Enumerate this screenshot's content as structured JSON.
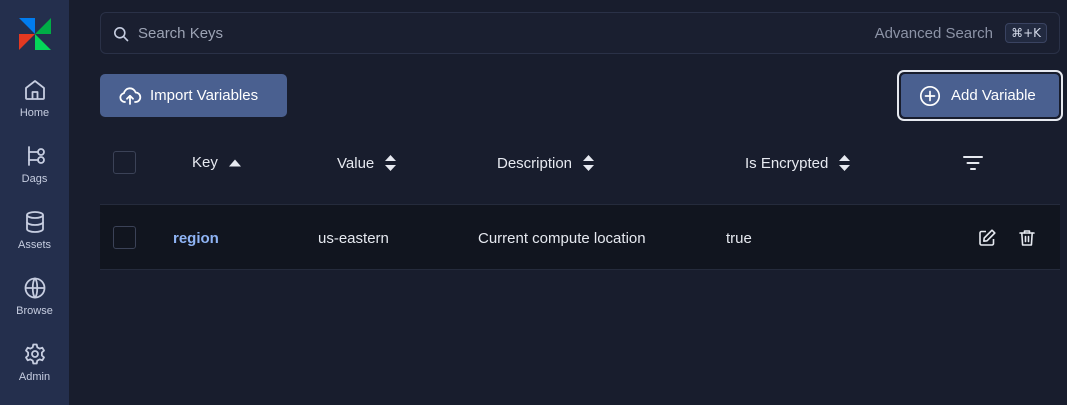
{
  "sidebar": {
    "items": [
      {
        "label": "Home",
        "icon": "home-icon"
      },
      {
        "label": "Dags",
        "icon": "dags-icon"
      },
      {
        "label": "Assets",
        "icon": "database-icon"
      },
      {
        "label": "Browse",
        "icon": "globe-icon"
      },
      {
        "label": "Admin",
        "icon": "gear-icon"
      }
    ]
  },
  "search": {
    "placeholder": "Search Keys",
    "advanced_label": "Advanced Search",
    "shortcut": "⌘+K"
  },
  "toolbar": {
    "import_label": "Import Variables",
    "add_label": "Add Variable"
  },
  "table": {
    "columns": [
      "Key",
      "Value",
      "Description",
      "Is Encrypted"
    ],
    "rows": [
      {
        "key": "region",
        "value": "us-eastern",
        "description": "Current compute location",
        "is_encrypted": "true"
      }
    ]
  },
  "colors": {
    "sidebar_bg": "#242f4d",
    "page_bg": "#181d2d",
    "button_bg": "#4a6090",
    "link": "#8fb4f5"
  }
}
